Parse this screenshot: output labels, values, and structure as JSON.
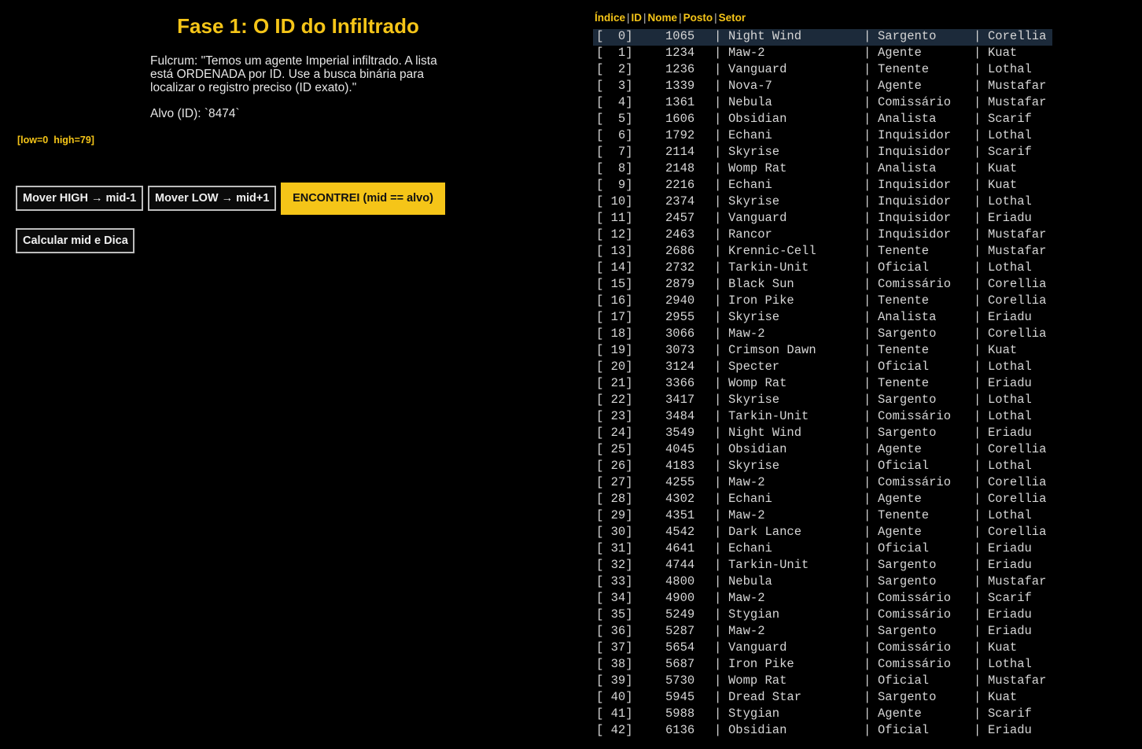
{
  "left": {
    "title": "Fase 1: O ID do Infiltrado",
    "briefing": "Fulcrum: \"Temos um agente Imperial infiltrado. A lista está ORDENADA por ID. Use a busca binária para localizar o registro preciso (ID exato).\"",
    "target": "Alvo (ID): `8474`",
    "bounds": "[low=0  high=79]",
    "buttons": {
      "move_high": "Mover HIGH → mid-1",
      "move_low": "Mover LOW → mid+1",
      "found": "ENCONTREI (mid == alvo)",
      "calc_mid": "Calcular mid e Dica"
    }
  },
  "table": {
    "headers": [
      "Índice",
      "ID",
      "Nome",
      "Posto",
      "Setor"
    ],
    "separator": "|",
    "rows": [
      [
        "[  0]",
        "1065",
        "Night Wind",
        "Sargento",
        "Corellia"
      ],
      [
        "[  1]",
        "1234",
        "Maw-2",
        "Agente",
        "Kuat"
      ],
      [
        "[  2]",
        "1236",
        "Vanguard",
        "Tenente",
        "Lothal"
      ],
      [
        "[  3]",
        "1339",
        "Nova-7",
        "Agente",
        "Mustafar"
      ],
      [
        "[  4]",
        "1361",
        "Nebula",
        "Comissário",
        "Mustafar"
      ],
      [
        "[  5]",
        "1606",
        "Obsidian",
        "Analista",
        "Scarif"
      ],
      [
        "[  6]",
        "1792",
        "Echani",
        "Inquisidor",
        "Lothal"
      ],
      [
        "[  7]",
        "2114",
        "Skyrise",
        "Inquisidor",
        "Scarif"
      ],
      [
        "[  8]",
        "2148",
        "Womp Rat",
        "Analista",
        "Kuat"
      ],
      [
        "[  9]",
        "2216",
        "Echani",
        "Inquisidor",
        "Kuat"
      ],
      [
        "[ 10]",
        "2374",
        "Skyrise",
        "Inquisidor",
        "Lothal"
      ],
      [
        "[ 11]",
        "2457",
        "Vanguard",
        "Inquisidor",
        "Eriadu"
      ],
      [
        "[ 12]",
        "2463",
        "Rancor",
        "Inquisidor",
        "Mustafar"
      ],
      [
        "[ 13]",
        "2686",
        "Krennic-Cell",
        "Tenente",
        "Mustafar"
      ],
      [
        "[ 14]",
        "2732",
        "Tarkin-Unit",
        "Oficial",
        "Lothal"
      ],
      [
        "[ 15]",
        "2879",
        "Black Sun",
        "Comissário",
        "Corellia"
      ],
      [
        "[ 16]",
        "2940",
        "Iron Pike",
        "Tenente",
        "Corellia"
      ],
      [
        "[ 17]",
        "2955",
        "Skyrise",
        "Analista",
        "Eriadu"
      ],
      [
        "[ 18]",
        "3066",
        "Maw-2",
        "Sargento",
        "Corellia"
      ],
      [
        "[ 19]",
        "3073",
        "Crimson Dawn",
        "Tenente",
        "Kuat"
      ],
      [
        "[ 20]",
        "3124",
        "Specter",
        "Oficial",
        "Lothal"
      ],
      [
        "[ 21]",
        "3366",
        "Womp Rat",
        "Tenente",
        "Eriadu"
      ],
      [
        "[ 22]",
        "3417",
        "Skyrise",
        "Sargento",
        "Lothal"
      ],
      [
        "[ 23]",
        "3484",
        "Tarkin-Unit",
        "Comissário",
        "Lothal"
      ],
      [
        "[ 24]",
        "3549",
        "Night Wind",
        "Sargento",
        "Eriadu"
      ],
      [
        "[ 25]",
        "4045",
        "Obsidian",
        "Agente",
        "Corellia"
      ],
      [
        "[ 26]",
        "4183",
        "Skyrise",
        "Oficial",
        "Lothal"
      ],
      [
        "[ 27]",
        "4255",
        "Maw-2",
        "Comissário",
        "Corellia"
      ],
      [
        "[ 28]",
        "4302",
        "Echani",
        "Agente",
        "Corellia"
      ],
      [
        "[ 29]",
        "4351",
        "Maw-2",
        "Tenente",
        "Lothal"
      ],
      [
        "[ 30]",
        "4542",
        "Dark Lance",
        "Agente",
        "Corellia"
      ],
      [
        "[ 31]",
        "4641",
        "Echani",
        "Oficial",
        "Eriadu"
      ],
      [
        "[ 32]",
        "4744",
        "Tarkin-Unit",
        "Sargento",
        "Eriadu"
      ],
      [
        "[ 33]",
        "4800",
        "Nebula",
        "Sargento",
        "Mustafar"
      ],
      [
        "[ 34]",
        "4900",
        "Maw-2",
        "Comissário",
        "Scarif"
      ],
      [
        "[ 35]",
        "5249",
        "Stygian",
        "Comissário",
        "Eriadu"
      ],
      [
        "[ 36]",
        "5287",
        "Maw-2",
        "Sargento",
        "Eriadu"
      ],
      [
        "[ 37]",
        "5654",
        "Vanguard",
        "Comissário",
        "Kuat"
      ],
      [
        "[ 38]",
        "5687",
        "Iron Pike",
        "Comissário",
        "Lothal"
      ],
      [
        "[ 39]",
        "5730",
        "Womp Rat",
        "Oficial",
        "Mustafar"
      ],
      [
        "[ 40]",
        "5945",
        "Dread Star",
        "Sargento",
        "Kuat"
      ],
      [
        "[ 41]",
        "5988",
        "Stygian",
        "Agente",
        "Scarif"
      ],
      [
        "[ 42]",
        "6136",
        "Obsidian",
        "Oficial",
        "Eriadu"
      ]
    ],
    "highlighted_row": 0
  },
  "colors": {
    "background": "#000000",
    "accent": "#f5c518",
    "text": "#e6e6e6",
    "highlight": "#1c2a3a"
  }
}
